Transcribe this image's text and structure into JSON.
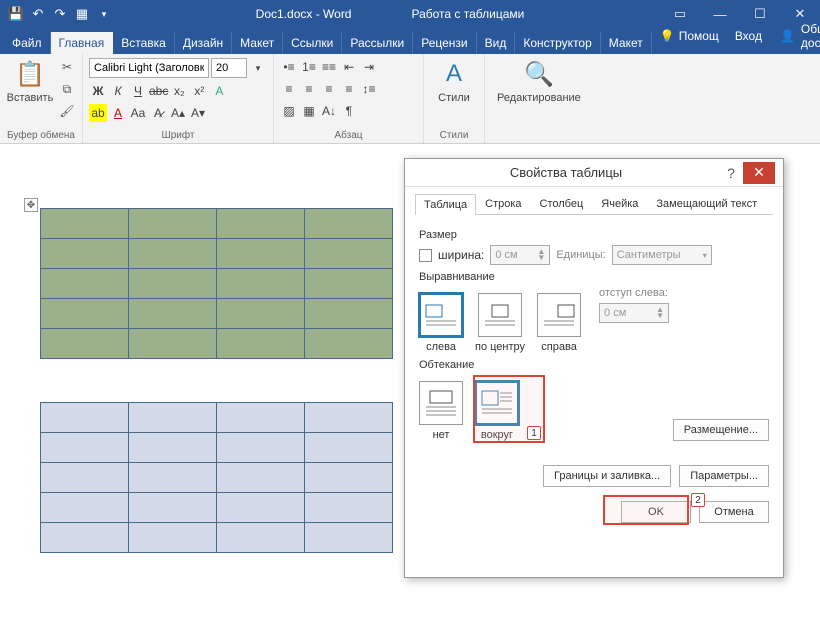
{
  "title": {
    "doc": "Doc1.docx - Word",
    "contextual": "Работа с таблицами"
  },
  "tabs": {
    "file": "Файл",
    "home": "Главная",
    "insert": "Вставка",
    "design": "Дизайн",
    "layout": "Макет",
    "references": "Ссылки",
    "mailings": "Рассылки",
    "review": "Рецензи",
    "view": "Вид",
    "constructor": "Конструктор",
    "tlayout": "Макет",
    "help": "Помощ",
    "signin": "Вход",
    "share": "Общий доступ"
  },
  "ribbon": {
    "clipboard": {
      "paste": "Вставить",
      "label": "Буфер обмена"
    },
    "font": {
      "name": "Calibri Light (Заголовк",
      "size": "20",
      "label": "Шрифт"
    },
    "paragraph": {
      "label": "Абзац"
    },
    "styles": {
      "btn": "Стили",
      "label": "Стили"
    },
    "editing": {
      "btn": "Редактирование"
    }
  },
  "dialog": {
    "title": "Свойства таблицы",
    "tabs": {
      "table": "Таблица",
      "row": "Строка",
      "column": "Столбец",
      "cell": "Ячейка",
      "alt": "Замещающий текст"
    },
    "size": {
      "label": "Размер",
      "width": "ширина:",
      "width_val": "0 см",
      "units": "Единицы:",
      "units_val": "Сантиметры"
    },
    "align": {
      "label": "Выравнивание",
      "left": "слева",
      "center": "по центру",
      "right": "справа",
      "indent": "отступ слева:",
      "indent_val": "0 см"
    },
    "wrap": {
      "label": "Обтекание",
      "none": "нет",
      "around": "вокруг",
      "placement": "Размещение..."
    },
    "borders": "Границы и заливка...",
    "params": "Параметры...",
    "ok": "OK",
    "cancel": "Отмена"
  },
  "markers": {
    "1": "1",
    "2": "2"
  }
}
